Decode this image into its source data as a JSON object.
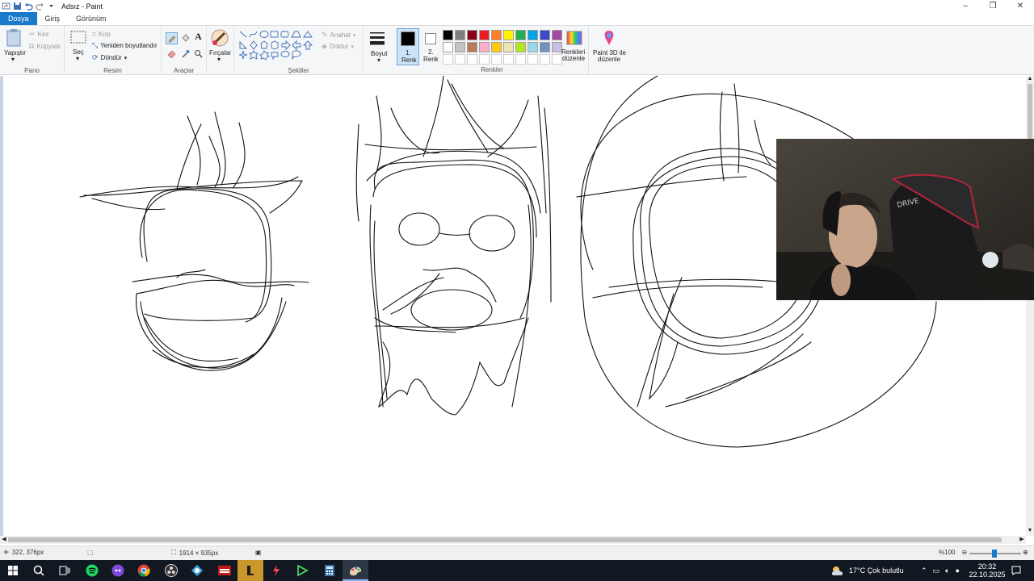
{
  "window": {
    "title": "Adsız - Paint"
  },
  "tabs": [
    {
      "label": "Dosya"
    },
    {
      "label": "Giriş"
    },
    {
      "label": "Görünüm"
    }
  ],
  "ribbon": {
    "clipboard": {
      "paste": "Yapıştır",
      "cut": "Kes",
      "copy": "Kopyala",
      "group": "Pano"
    },
    "image": {
      "select": "Seç",
      "crop": "Kırp",
      "resize": "Yeniden boyutlandır",
      "rotate": "Döndür",
      "group": "Resim"
    },
    "tools": {
      "group": "Araçlar"
    },
    "brushes": {
      "label": "Fırçalar"
    },
    "shapes": {
      "outline": "Anahat",
      "fill": "Doldur",
      "group": "Şekiller"
    },
    "size": {
      "label": "Boyut"
    },
    "colors": {
      "color1": "1.\nRenk",
      "color1_a": "1.",
      "color1_b": "Renk",
      "color2_a": "2.",
      "color2_b": "Renk",
      "edit_a": "Renkleri",
      "edit_b": "düzenle",
      "group": "Renkler",
      "palette_row1": [
        "#000000",
        "#7f7f7f",
        "#880015",
        "#ed1c24",
        "#ff7f27",
        "#fff200",
        "#22b14c",
        "#00a2e8",
        "#3f48cc",
        "#a349a4"
      ],
      "palette_row2": [
        "#ffffff",
        "#c3c3c3",
        "#b97a57",
        "#ffaec9",
        "#ffc90e",
        "#efe4b0",
        "#b5e61d",
        "#99d9ea",
        "#7092be",
        "#c8bfe7"
      ]
    },
    "paint3d": {
      "a": "Paint 3D ile",
      "b": "düzenle"
    }
  },
  "status": {
    "cursor": "322, 376px",
    "canvas_size": "1914 × 935px",
    "zoom": "%100"
  },
  "taskbar": {
    "weather": "17°C Çok bulutlu",
    "time": "20:32",
    "date": "22.10.2025"
  }
}
